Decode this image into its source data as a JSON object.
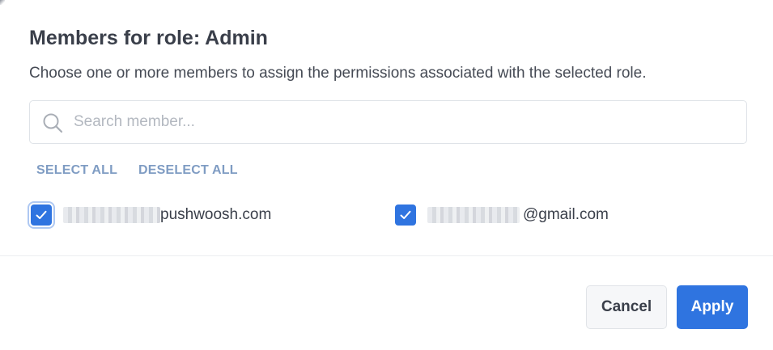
{
  "dialog": {
    "title": "Members for role: Admin",
    "description": "Choose one or more members to assign the permissions associated with the selected role."
  },
  "search": {
    "placeholder": "Search member...",
    "value": "",
    "icon": "search-icon"
  },
  "selection": {
    "select_all_label": "SELECT ALL",
    "deselect_all_label": "DESELECT ALL"
  },
  "members": [
    {
      "email_domain": "pushwoosh.com",
      "checked": true
    },
    {
      "email_domain": "@gmail.com",
      "checked": true
    }
  ],
  "footer": {
    "cancel_label": "Cancel",
    "apply_label": "Apply"
  },
  "colors": {
    "accent": "#2f74e0",
    "link": "#7f9cc3",
    "text": "#3a3f4a"
  }
}
